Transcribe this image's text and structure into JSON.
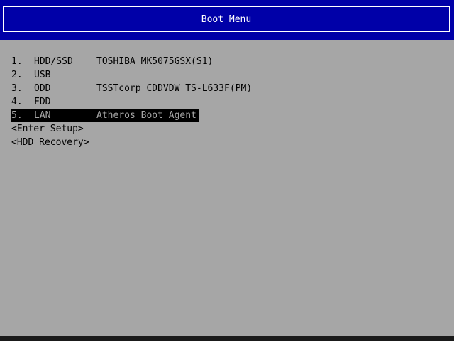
{
  "title": "Boot Menu",
  "colors": {
    "title_band": "#0000a8",
    "title_text": "#ffffff",
    "background": "#a6a6a6",
    "text": "#000000",
    "selection_bg": "#000000",
    "selection_text": "#a6a6a6"
  },
  "boot_devices": [
    {
      "number": "1.",
      "device": "HDD/SSD",
      "description": "TOSHIBA MK5075GSX(S1)"
    },
    {
      "number": "2.",
      "device": "USB",
      "description": ""
    },
    {
      "number": "3.",
      "device": "ODD",
      "description": "TSSTcorp CDDVDW TS-L633F(PM)"
    },
    {
      "number": "4.",
      "device": "FDD",
      "description": ""
    },
    {
      "number": "5.",
      "device": "LAN",
      "description": "Atheros Boot Agent"
    }
  ],
  "selected_index": 4,
  "options": [
    {
      "label": "<Enter Setup>"
    },
    {
      "label": "<HDD Recovery>"
    }
  ]
}
